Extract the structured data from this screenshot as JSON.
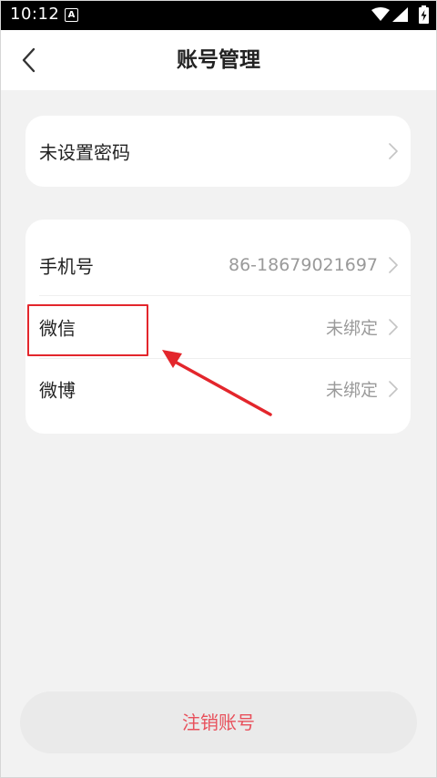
{
  "status_bar": {
    "time": "10:12",
    "notification_icon": "a-icon"
  },
  "header": {
    "title": "账号管理",
    "back_icon": "back-chevron-icon"
  },
  "password_card": {
    "label": "未设置密码"
  },
  "binding_card": {
    "rows": [
      {
        "label": "手机号",
        "value": "86-18679021697"
      },
      {
        "label": "微信",
        "value": "未绑定"
      },
      {
        "label": "微博",
        "value": "未绑定"
      }
    ]
  },
  "footer": {
    "cancel_account_label": "注销账号"
  },
  "colors": {
    "accent_red": "#e3262c",
    "cancel_text": "#e8505b",
    "background": "#f2f2f2"
  }
}
